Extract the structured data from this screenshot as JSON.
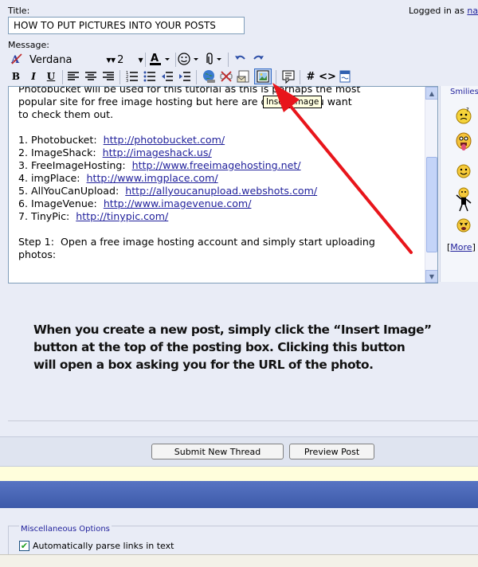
{
  "header": {
    "title_label": "Title:",
    "logged_in_text": "Logged in as ",
    "logged_in_user": "na"
  },
  "title_field": {
    "value": "HOW TO PUT PICTURES INTO YOUR POSTS"
  },
  "message_label": "Message:",
  "toolbar": {
    "font_value": "Verdana",
    "size_value": "2",
    "bold": "B",
    "italic": "I",
    "underline": "U",
    "hash": "#",
    "code": "<>"
  },
  "tooltip": "Insert Image",
  "editor": {
    "intro_line1": "Photobucket will be used for this tutorial as this is perhaps the most",
    "intro_line2": "popular site for free image hosting but here are others if you want",
    "intro_line3": "to check them out.",
    "sites": [
      {
        "label": "1. Photobucket:",
        "url": "http://photobucket.com/"
      },
      {
        "label": "2. ImageShack:",
        "url": "http://imageshack.us/"
      },
      {
        "label": "3. FreeImageHosting:",
        "url": "http://www.freeimagehosting.net/"
      },
      {
        "label": "4. imgPlace:",
        "url": "http://www.imgplace.com/"
      },
      {
        "label": "5. AllYouCanUpload:",
        "url": "http://allyoucanupload.webshots.com/"
      },
      {
        "label": "6. ImageVenue:",
        "url": "http://www.imagevenue.com/"
      },
      {
        "label": "7. TinyPic:",
        "url": "http://tinypic.com/"
      }
    ],
    "step_line1": "Step 1:  Open a free image hosting account and simply start uploading",
    "step_line2": "photos:"
  },
  "smilies": {
    "title": "Smilies",
    "more_open": "[",
    "more_link": "More",
    "more_close": "]"
  },
  "annotation": {
    "line1": "When you create a new post, simply click the “Insert Image”",
    "line2": "button at the top of the posting box.  Clicking this button",
    "line3": "will open a box asking you for the URL of the photo."
  },
  "buttons": {
    "submit": "Submit New Thread",
    "preview": "Preview Post"
  },
  "misc": {
    "title": "Miscellaneous Options",
    "checkbox_label": "Automatically parse links in text",
    "checkbox_checked": true
  },
  "colors": {
    "link": "#22229c",
    "arrow": "#e8151b",
    "page_bg": "#e9ecf6",
    "blue_band": "#4664b6"
  }
}
